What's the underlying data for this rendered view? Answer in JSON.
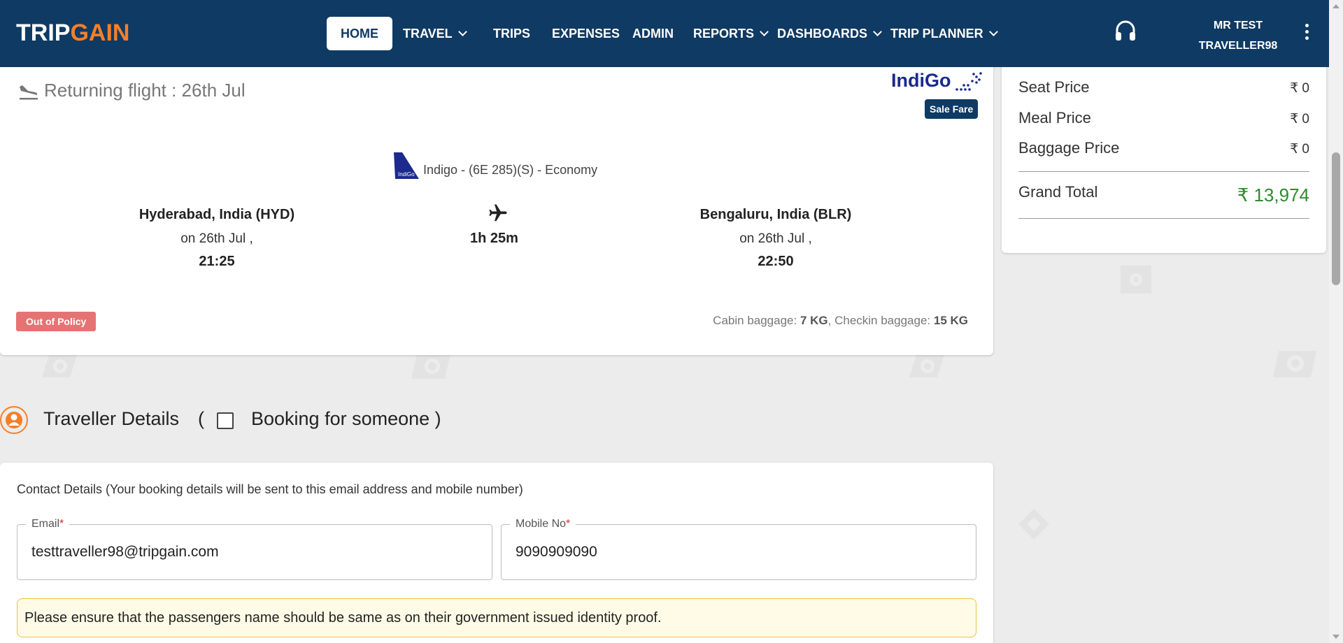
{
  "nav": {
    "logo_part1": "TRIP",
    "logo_part2": "GAIN",
    "items": [
      {
        "label": "HOME"
      },
      {
        "label": "TRAVEL"
      },
      {
        "label": "TRIPS"
      },
      {
        "label": "EXPENSES"
      },
      {
        "label": "ADMIN"
      },
      {
        "label": "REPORTS"
      },
      {
        "label": "DASHBOARDS"
      },
      {
        "label": "TRIP PLANNER"
      }
    ],
    "user_line1": "MR TEST",
    "user_line2": "TRAVELLER98"
  },
  "flight": {
    "title": "Returning flight : 26th Jul",
    "airline_logo": "IndiGo",
    "fare_badge": "Sale Fare",
    "flight_info": "Indigo - (6E 285)(S) - Economy",
    "departure": {
      "city": "Hyderabad, India (HYD)",
      "date": "on 26th Jul ,",
      "time": "21:25"
    },
    "arrival": {
      "city": "Bengaluru, India (BLR)",
      "date": "on 26th Jul ,",
      "time": "22:50"
    },
    "duration": "1h 25m",
    "policy_badge": "Out of Policy",
    "cabin_label": "Cabin baggage: ",
    "cabin_value": "7 KG",
    "checkin_label": ", Checkin baggage: ",
    "checkin_value": "15 KG"
  },
  "price": {
    "rows": [
      {
        "label": "Seat Price",
        "value": "₹ 0"
      },
      {
        "label": "Meal Price",
        "value": "₹ 0"
      },
      {
        "label": "Baggage Price",
        "value": "₹ 0"
      }
    ],
    "grand_label": "Grand Total",
    "grand_value": "₹ 13,974",
    "grand_color": "#2e8b2e"
  },
  "traveller": {
    "title": "Traveller Details",
    "paren_open": "(",
    "booking_label": "Booking for someone )",
    "booking_checked": false
  },
  "contact": {
    "label": "Contact Details (Your booking details will be sent to this email address and mobile number)",
    "email_label": "Email",
    "email_value": "testtraveller98@tripgain.com",
    "mobile_label": "Mobile No",
    "mobile_value": "9090909090",
    "required_mark": "*",
    "notice": "Please ensure that the passengers name should be same as on their government issued identity proof."
  },
  "colors": {
    "nav_bg": "#0f3a63",
    "accent": "#f57f29",
    "policy_badge": "#e57373",
    "grand_total": "#2e8b2e"
  }
}
